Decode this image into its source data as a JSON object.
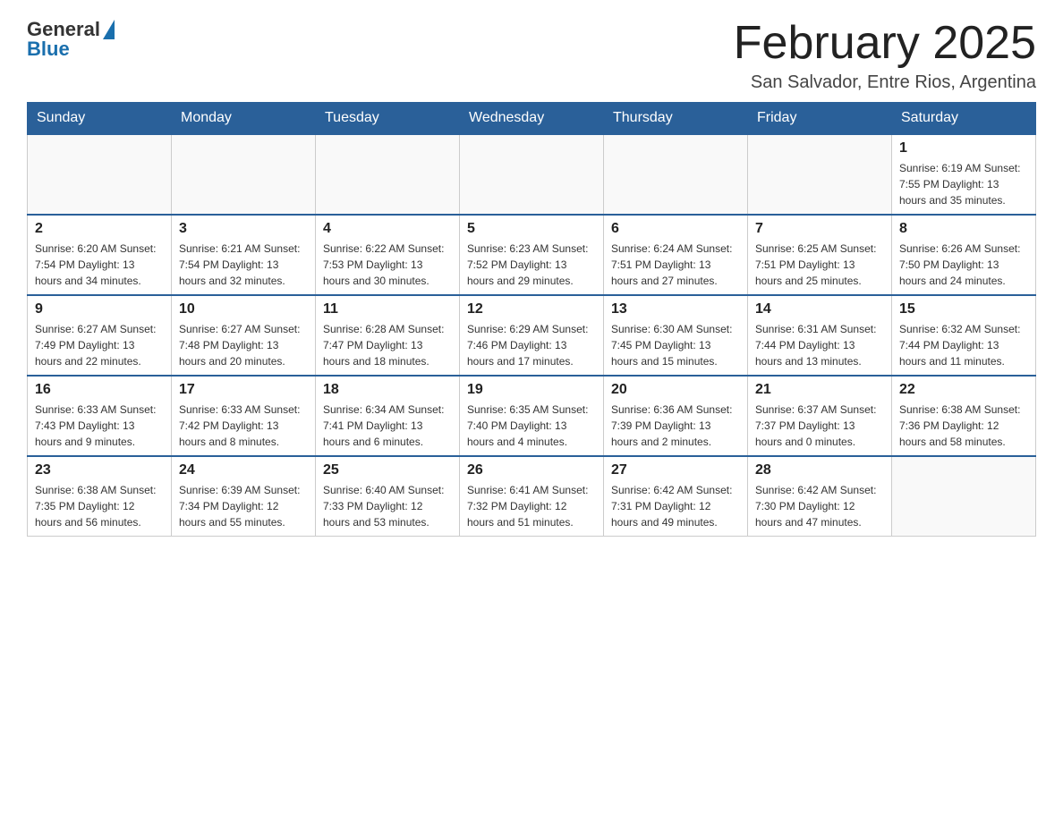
{
  "header": {
    "logo": {
      "general": "General",
      "blue": "Blue",
      "triangle": "▲"
    },
    "title": "February 2025",
    "subtitle": "San Salvador, Entre Rios, Argentina"
  },
  "weekdays": [
    "Sunday",
    "Monday",
    "Tuesday",
    "Wednesday",
    "Thursday",
    "Friday",
    "Saturday"
  ],
  "weeks": [
    [
      {
        "day": "",
        "info": ""
      },
      {
        "day": "",
        "info": ""
      },
      {
        "day": "",
        "info": ""
      },
      {
        "day": "",
        "info": ""
      },
      {
        "day": "",
        "info": ""
      },
      {
        "day": "",
        "info": ""
      },
      {
        "day": "1",
        "info": "Sunrise: 6:19 AM\nSunset: 7:55 PM\nDaylight: 13 hours and 35 minutes."
      }
    ],
    [
      {
        "day": "2",
        "info": "Sunrise: 6:20 AM\nSunset: 7:54 PM\nDaylight: 13 hours and 34 minutes."
      },
      {
        "day": "3",
        "info": "Sunrise: 6:21 AM\nSunset: 7:54 PM\nDaylight: 13 hours and 32 minutes."
      },
      {
        "day": "4",
        "info": "Sunrise: 6:22 AM\nSunset: 7:53 PM\nDaylight: 13 hours and 30 minutes."
      },
      {
        "day": "5",
        "info": "Sunrise: 6:23 AM\nSunset: 7:52 PM\nDaylight: 13 hours and 29 minutes."
      },
      {
        "day": "6",
        "info": "Sunrise: 6:24 AM\nSunset: 7:51 PM\nDaylight: 13 hours and 27 minutes."
      },
      {
        "day": "7",
        "info": "Sunrise: 6:25 AM\nSunset: 7:51 PM\nDaylight: 13 hours and 25 minutes."
      },
      {
        "day": "8",
        "info": "Sunrise: 6:26 AM\nSunset: 7:50 PM\nDaylight: 13 hours and 24 minutes."
      }
    ],
    [
      {
        "day": "9",
        "info": "Sunrise: 6:27 AM\nSunset: 7:49 PM\nDaylight: 13 hours and 22 minutes."
      },
      {
        "day": "10",
        "info": "Sunrise: 6:27 AM\nSunset: 7:48 PM\nDaylight: 13 hours and 20 minutes."
      },
      {
        "day": "11",
        "info": "Sunrise: 6:28 AM\nSunset: 7:47 PM\nDaylight: 13 hours and 18 minutes."
      },
      {
        "day": "12",
        "info": "Sunrise: 6:29 AM\nSunset: 7:46 PM\nDaylight: 13 hours and 17 minutes."
      },
      {
        "day": "13",
        "info": "Sunrise: 6:30 AM\nSunset: 7:45 PM\nDaylight: 13 hours and 15 minutes."
      },
      {
        "day": "14",
        "info": "Sunrise: 6:31 AM\nSunset: 7:44 PM\nDaylight: 13 hours and 13 minutes."
      },
      {
        "day": "15",
        "info": "Sunrise: 6:32 AM\nSunset: 7:44 PM\nDaylight: 13 hours and 11 minutes."
      }
    ],
    [
      {
        "day": "16",
        "info": "Sunrise: 6:33 AM\nSunset: 7:43 PM\nDaylight: 13 hours and 9 minutes."
      },
      {
        "day": "17",
        "info": "Sunrise: 6:33 AM\nSunset: 7:42 PM\nDaylight: 13 hours and 8 minutes."
      },
      {
        "day": "18",
        "info": "Sunrise: 6:34 AM\nSunset: 7:41 PM\nDaylight: 13 hours and 6 minutes."
      },
      {
        "day": "19",
        "info": "Sunrise: 6:35 AM\nSunset: 7:40 PM\nDaylight: 13 hours and 4 minutes."
      },
      {
        "day": "20",
        "info": "Sunrise: 6:36 AM\nSunset: 7:39 PM\nDaylight: 13 hours and 2 minutes."
      },
      {
        "day": "21",
        "info": "Sunrise: 6:37 AM\nSunset: 7:37 PM\nDaylight: 13 hours and 0 minutes."
      },
      {
        "day": "22",
        "info": "Sunrise: 6:38 AM\nSunset: 7:36 PM\nDaylight: 12 hours and 58 minutes."
      }
    ],
    [
      {
        "day": "23",
        "info": "Sunrise: 6:38 AM\nSunset: 7:35 PM\nDaylight: 12 hours and 56 minutes."
      },
      {
        "day": "24",
        "info": "Sunrise: 6:39 AM\nSunset: 7:34 PM\nDaylight: 12 hours and 55 minutes."
      },
      {
        "day": "25",
        "info": "Sunrise: 6:40 AM\nSunset: 7:33 PM\nDaylight: 12 hours and 53 minutes."
      },
      {
        "day": "26",
        "info": "Sunrise: 6:41 AM\nSunset: 7:32 PM\nDaylight: 12 hours and 51 minutes."
      },
      {
        "day": "27",
        "info": "Sunrise: 6:42 AM\nSunset: 7:31 PM\nDaylight: 12 hours and 49 minutes."
      },
      {
        "day": "28",
        "info": "Sunrise: 6:42 AM\nSunset: 7:30 PM\nDaylight: 12 hours and 47 minutes."
      },
      {
        "day": "",
        "info": ""
      }
    ]
  ]
}
